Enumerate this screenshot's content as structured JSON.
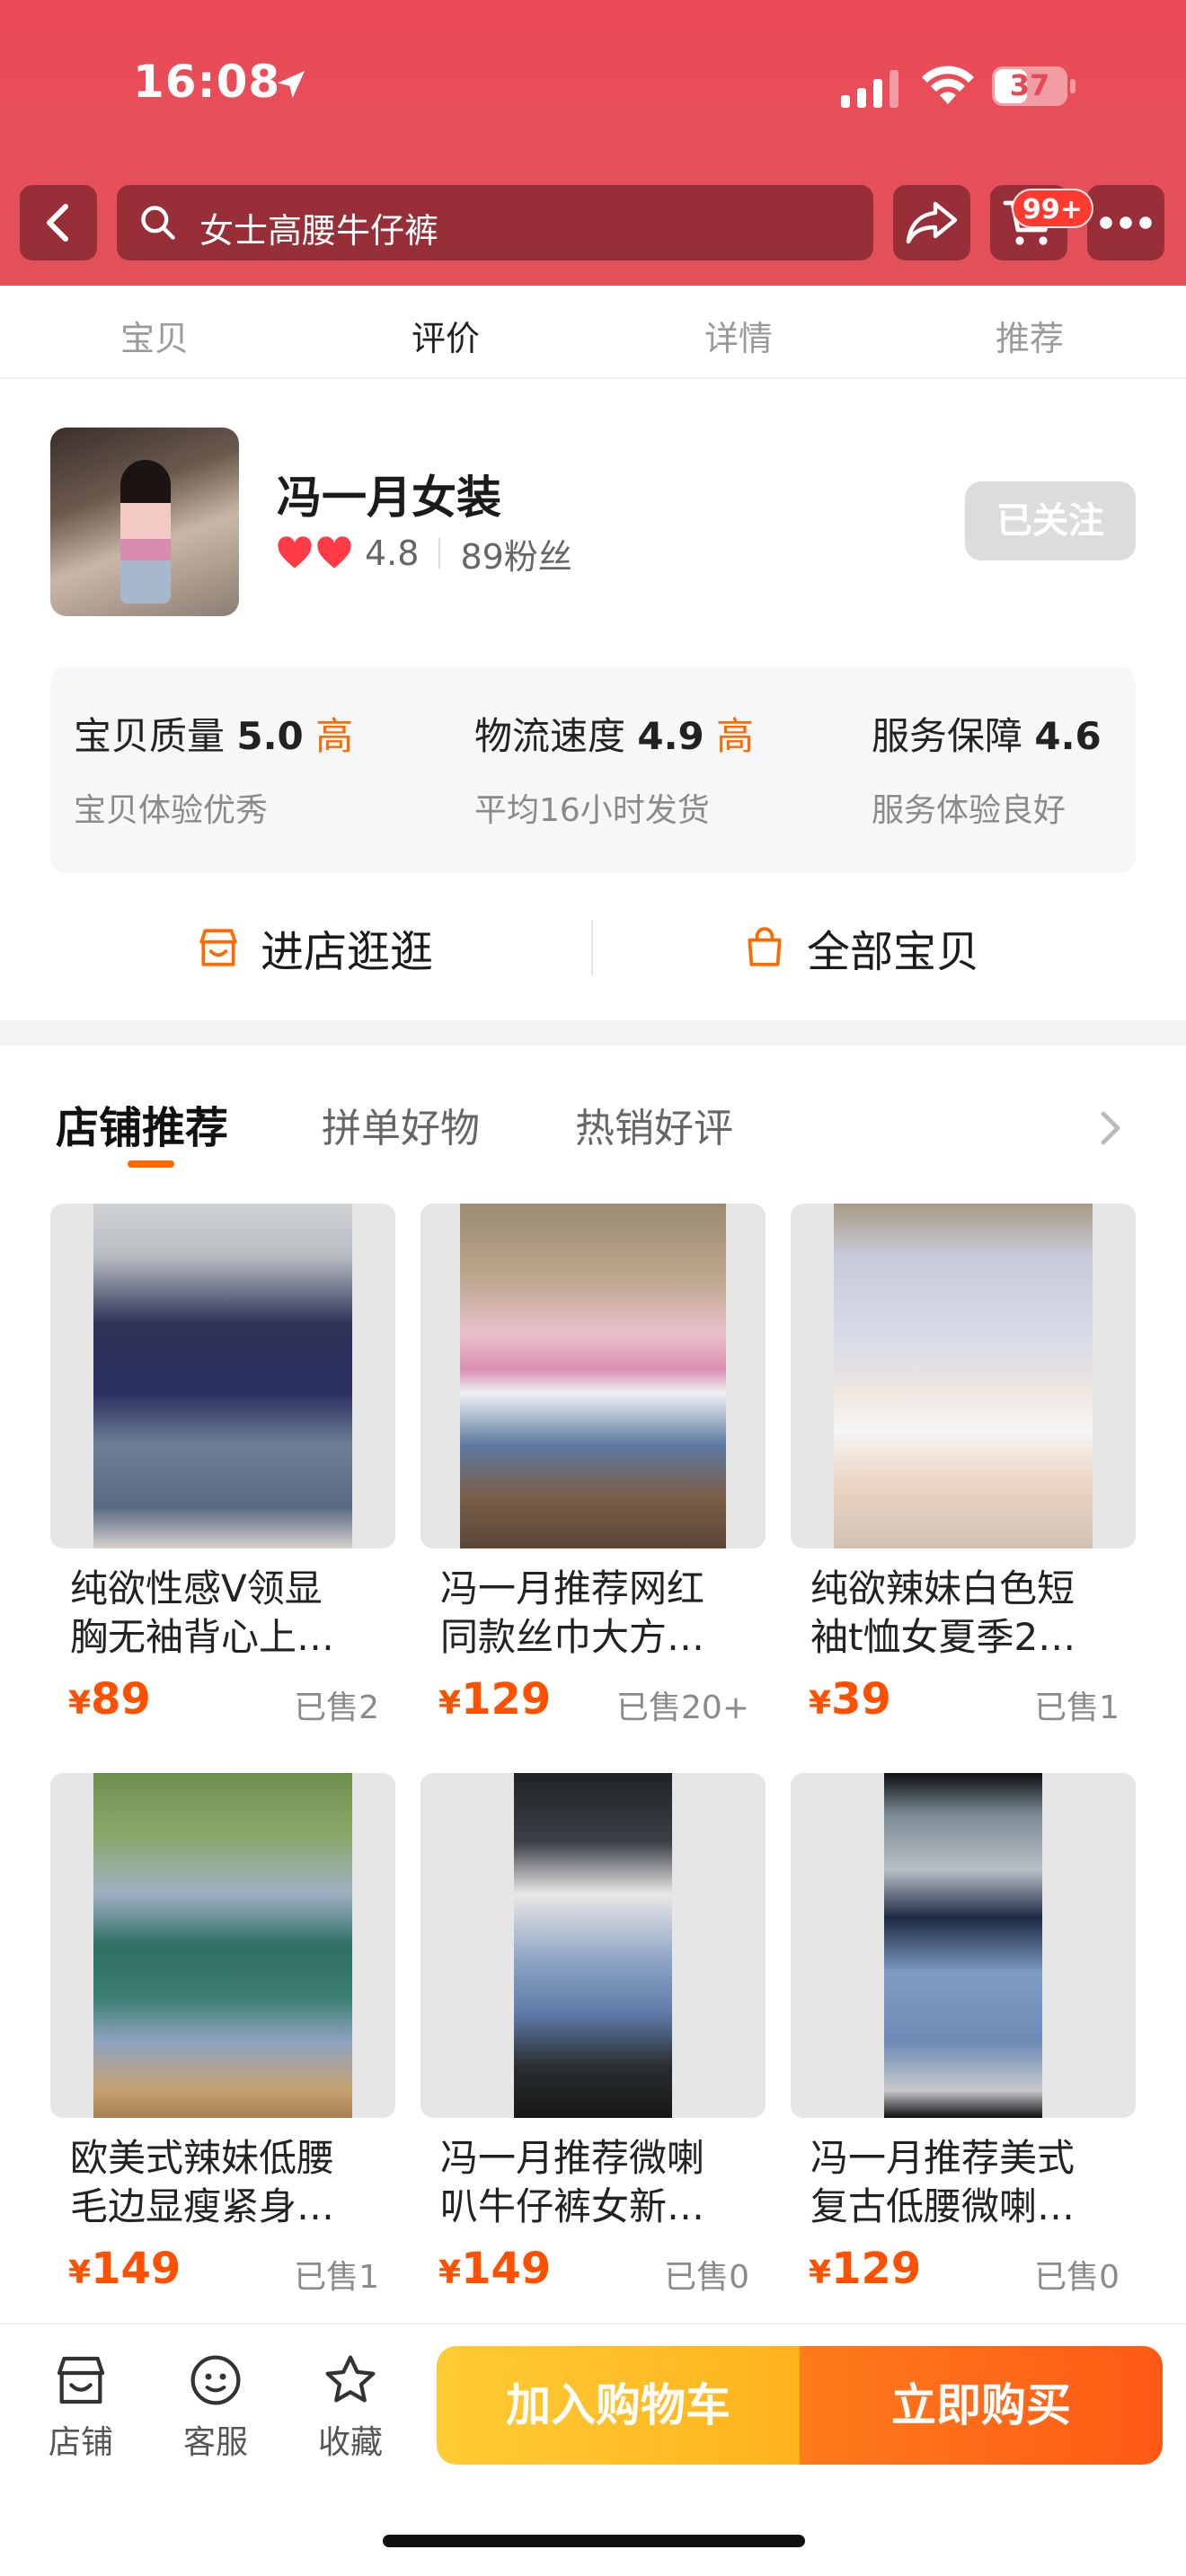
{
  "status_bar": {
    "time": "16:08",
    "battery": "37"
  },
  "header": {
    "search_text": "女士高腰牛仔裤",
    "cart_badge": "99+"
  },
  "tabs": [
    {
      "label": "宝贝",
      "active": false
    },
    {
      "label": "评价",
      "active": true
    },
    {
      "label": "详情",
      "active": false
    },
    {
      "label": "推荐",
      "active": false
    }
  ],
  "shop": {
    "name": "冯一月女装",
    "rating": "4.8",
    "fans": "89粉丝",
    "follow_label": "已关注",
    "metrics": [
      {
        "label": "宝贝质量",
        "score": "5.0",
        "level": "高",
        "desc": "宝贝体验优秀"
      },
      {
        "label": "物流速度",
        "score": "4.9",
        "level": "高",
        "desc": "平均16小时发货"
      },
      {
        "label": "服务保障",
        "score": "4.6",
        "level": "",
        "desc": "服务体验良好"
      }
    ],
    "visit_label": "进店逛逛",
    "all_items_label": "全部宝贝"
  },
  "recommend": {
    "tabs": [
      "店铺推荐",
      "拼单好物",
      "热销好评"
    ],
    "products": [
      {
        "title1": "纯欲性感V领显",
        "title2": "胸无袖背心上…",
        "currency": "¥",
        "price": "89",
        "sold": "已售2"
      },
      {
        "title1": "冯一月推荐网红",
        "title2": "同款丝巾大方…",
        "currency": "¥",
        "price": "129",
        "sold": "已售20+"
      },
      {
        "title1": "纯欲辣妹白色短",
        "title2": "袖t恤女夏季2…",
        "currency": "¥",
        "price": "39",
        "sold": "已售1"
      },
      {
        "title1": "欧美式辣妹低腰",
        "title2": "毛边显瘦紧身…",
        "currency": "¥",
        "price": "149",
        "sold": "已售1"
      },
      {
        "title1": "冯一月推荐微喇",
        "title2": "叭牛仔裤女新…",
        "currency": "¥",
        "price": "149",
        "sold": "已售0"
      },
      {
        "title1": "冯一月推荐美式",
        "title2": "复古低腰微喇…",
        "currency": "¥",
        "price": "129",
        "sold": "已售0"
      }
    ]
  },
  "bottom_bar": {
    "store_label": "店铺",
    "service_label": "客服",
    "favorite_label": "收藏",
    "add_cart_label": "加入购物车",
    "buy_now_label": "立即购买"
  },
  "colors": {
    "accent": "#ff6a00",
    "price": "#ff5000",
    "header": "#e6505a"
  }
}
